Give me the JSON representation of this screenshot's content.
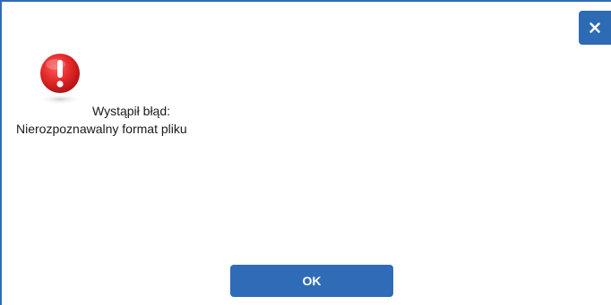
{
  "dialog": {
    "close_icon": "close-icon",
    "error_icon": "error-exclamation-icon",
    "message_line1": "Wystąpił błąd:",
    "message_line2": "Nierozpoznawalny format pliku",
    "ok_label": "OK"
  },
  "colors": {
    "accent": "#2f6bb6",
    "error_red": "#e02626"
  }
}
